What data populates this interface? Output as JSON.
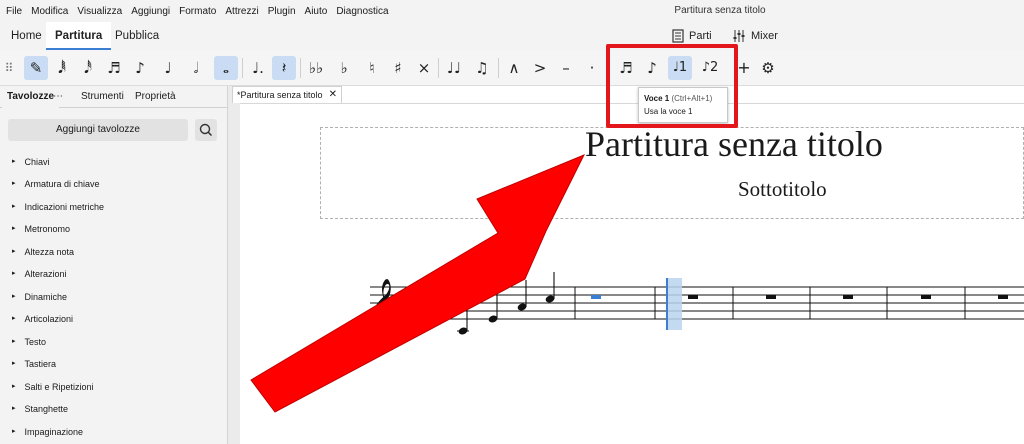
{
  "menu": [
    "File",
    "Modifica",
    "Visualizza",
    "Aggiungi",
    "Formato",
    "Attrezzi",
    "Plugin",
    "Aiuto",
    "Diagnostica"
  ],
  "window_title": "Partitura senza titolo",
  "workspace_tabs": [
    "Home",
    "Partitura",
    "Pubblica"
  ],
  "right_buttons": {
    "parts": "Parti",
    "mixer": "Mixer"
  },
  "panel": {
    "tabs": [
      "Tavolozze",
      "Strumenti",
      "Proprietà"
    ],
    "more": "⋯",
    "add_button": "Aggiungi tavolozze",
    "items": [
      "Chiavi",
      "Armatura di chiave",
      "Indicazioni metriche",
      "Metronomo",
      "Altezza nota",
      "Alterazioni",
      "Dinamiche",
      "Articolazioni",
      "Testo",
      "Tastiera",
      "Salti e Ripetizioni",
      "Stanghette",
      "Impaginazione"
    ]
  },
  "document_tab": "*Partitura senza titolo",
  "score": {
    "title": "Partitura senza titolo",
    "subtitle": "Sottotitolo"
  },
  "tooltip": {
    "name": "Voce 1",
    "shortcut": "(Ctrl+Alt+1)",
    "description": "Usa la voce 1"
  },
  "toolbar_icons": [
    "input-mode-pencil",
    "sixty-fourth-note",
    "thirty-second-note",
    "sixteenth-note",
    "eighth-note",
    "quarter-note",
    "half-note",
    "whole-note",
    "dot",
    "rest",
    "double-flat",
    "flat",
    "natural",
    "sharp",
    "double-sharp",
    "tie",
    "slur",
    "marcato",
    "accent",
    "tenuto",
    "staccato",
    "tuplet",
    "flip",
    "voice-1",
    "voice-2",
    "add",
    "gear"
  ],
  "colors": {
    "highlight_red": "#e3161b",
    "arrow_red": "#ff0000",
    "selection_blue": "#3b7fd4",
    "active_tool": "#c9dcf3"
  }
}
